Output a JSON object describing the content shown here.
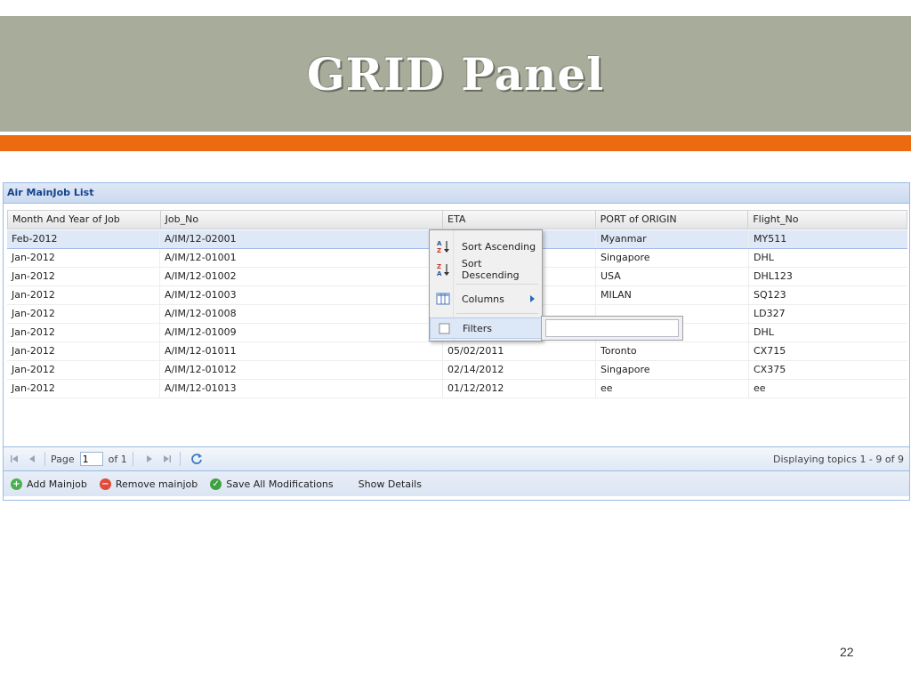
{
  "slide": {
    "title": "GRID Panel",
    "page_number": "22"
  },
  "panel": {
    "title": "Air MainJob List"
  },
  "columns": [
    "Month And Year of Job",
    "Job_No",
    "ETA",
    "PORT of ORIGIN",
    "Flight_No"
  ],
  "rows": [
    [
      "Feb-2012",
      "A/IM/12-02001",
      "",
      "Myanmar",
      "MY511"
    ],
    [
      "Jan-2012",
      "A/IM/12-01001",
      "",
      "Singapore",
      "DHL"
    ],
    [
      "Jan-2012",
      "A/IM/12-01002",
      "",
      "USA",
      "DHL123"
    ],
    [
      "Jan-2012",
      "A/IM/12-01003",
      "",
      "MILAN",
      "SQ123"
    ],
    [
      "Jan-2012",
      "A/IM/12-01008",
      "",
      "",
      "LD327"
    ],
    [
      "Jan-2012",
      "A/IM/12-01009",
      "",
      "",
      "DHL"
    ],
    [
      "Jan-2012",
      "A/IM/12-01011",
      "05/02/2011",
      "Toronto",
      "CX715"
    ],
    [
      "Jan-2012",
      "A/IM/12-01012",
      "02/14/2012",
      "Singapore",
      "CX375"
    ],
    [
      "Jan-2012",
      "A/IM/12-01013",
      "01/12/2012",
      "ee",
      "ee"
    ]
  ],
  "selected_row": 0,
  "context_menu": {
    "sort_ascending": "Sort Ascending",
    "sort_descending": "Sort Descending",
    "columns": "Columns",
    "filters": "Filters",
    "filter_value": ""
  },
  "pager": {
    "page_label": "Page",
    "page_value": "1",
    "of_label": "of 1",
    "display_info": "Displaying topics 1 - 9 of 9"
  },
  "toolbar": {
    "add": "Add Mainjob",
    "remove": "Remove mainjob",
    "save": "Save All Modifications",
    "show_details": "Show Details"
  },
  "colors": {
    "title_band": "#a8ac9b",
    "accent_bar": "#ec6a10",
    "panel_border": "#99bbe8",
    "header_text": "#15428b",
    "add_icon": "#4caf50",
    "remove_icon": "#e24a3b",
    "save_icon": "#3fa142"
  },
  "icons": {
    "first": "first-page-icon",
    "prev": "prev-page-icon",
    "next": "next-page-icon",
    "last": "last-page-icon",
    "refresh": "refresh-icon"
  }
}
